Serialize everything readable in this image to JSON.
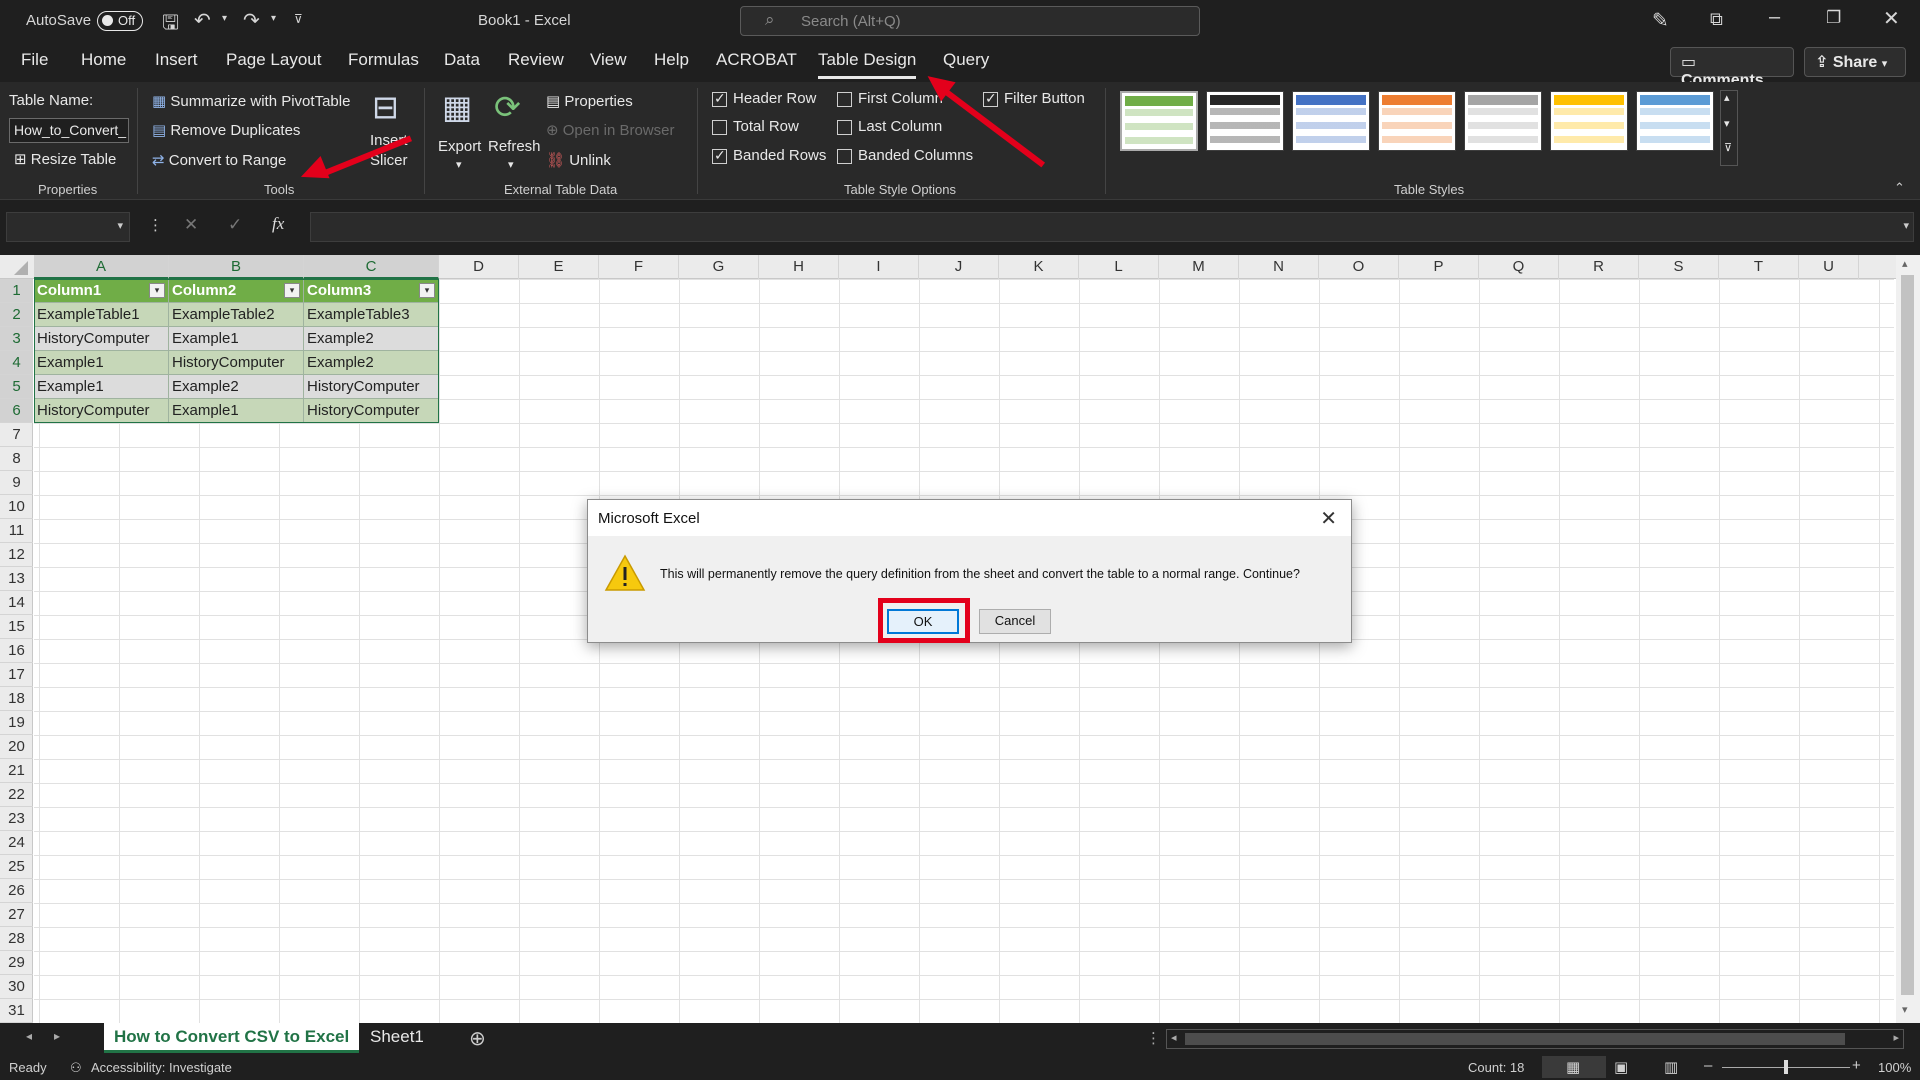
{
  "titlebar": {
    "autosave_label": "AutoSave",
    "autosave_state": "Off",
    "document_title": "Book1  -  Excel",
    "search_placeholder": "Search (Alt+Q)"
  },
  "tabs": [
    "File",
    "Home",
    "Insert",
    "Page Layout",
    "Formulas",
    "Data",
    "Review",
    "View",
    "Help",
    "ACROBAT",
    "Table Design",
    "Query"
  ],
  "active_tab": "Table Design",
  "top_buttons": {
    "comments": "Comments",
    "share": "Share"
  },
  "ribbon": {
    "properties": {
      "table_name_label": "Table Name:",
      "table_name_value": "How_to_Convert_",
      "resize_table": "Resize Table",
      "group": "Properties"
    },
    "tools": {
      "summarize": "Summarize with PivotTable",
      "remove_duplicates": "Remove Duplicates",
      "convert_to_range": "Convert to Range",
      "insert_slicer_line1": "Insert",
      "insert_slicer_line2": "Slicer",
      "group": "Tools"
    },
    "external": {
      "export": "Export",
      "refresh": "Refresh",
      "properties": "Properties",
      "open_in_browser": "Open in Browser",
      "unlink": "Unlink",
      "group": "External Table Data"
    },
    "style_options": {
      "header_row": "Header Row",
      "total_row": "Total Row",
      "banded_rows": "Banded Rows",
      "first_column": "First Column",
      "last_column": "Last Column",
      "banded_columns": "Banded Columns",
      "filter_button": "Filter Button",
      "group": "Table Style Options"
    },
    "table_styles": {
      "group": "Table Styles",
      "swatch_colors": [
        "#70ad47",
        "#262626",
        "#4472c4",
        "#ed7d31",
        "#a5a5a5",
        "#ffc000",
        "#5b9bd5"
      ]
    }
  },
  "formula_bar": {
    "fx": "fx"
  },
  "columns": [
    "A",
    "B",
    "C",
    "D",
    "E",
    "F",
    "G",
    "H",
    "I",
    "J",
    "K",
    "L",
    "M",
    "N",
    "O",
    "P",
    "Q",
    "R",
    "S",
    "T",
    "U"
  ],
  "rows": [
    "1",
    "2",
    "3",
    "4",
    "5",
    "6",
    "7",
    "8",
    "9",
    "10",
    "11",
    "12",
    "13",
    "14",
    "15",
    "16",
    "17",
    "18",
    "19",
    "20",
    "21",
    "22",
    "23",
    "24",
    "25",
    "26",
    "27",
    "28",
    "29",
    "30",
    "31"
  ],
  "table": {
    "headers": [
      "Column1",
      "Column2",
      "Column3"
    ],
    "rows": [
      [
        "ExampleTable1",
        "ExampleTable2",
        "ExampleTable3"
      ],
      [
        "HistoryComputer",
        "Example1",
        "Example2"
      ],
      [
        "Example1",
        "HistoryComputer",
        "Example2"
      ],
      [
        "Example1",
        "Example2",
        "HistoryComputer"
      ],
      [
        "HistoryComputer",
        "Example1",
        "HistoryComputer"
      ]
    ]
  },
  "sheets": {
    "active": "How to Convert CSV to Excel",
    "other": "Sheet1"
  },
  "status": {
    "ready": "Ready",
    "accessibility": "Accessibility: Investigate",
    "count": "Count: 18",
    "zoom": "100%"
  },
  "dialog": {
    "title": "Microsoft Excel",
    "message": "This will permanently remove the query definition from the sheet and convert the table to a normal range. Continue?",
    "ok": "OK",
    "cancel": "Cancel"
  },
  "colors": {
    "accent_green": "#217346",
    "annotation_red": "#e3001b",
    "table_header": "#70ad47"
  }
}
